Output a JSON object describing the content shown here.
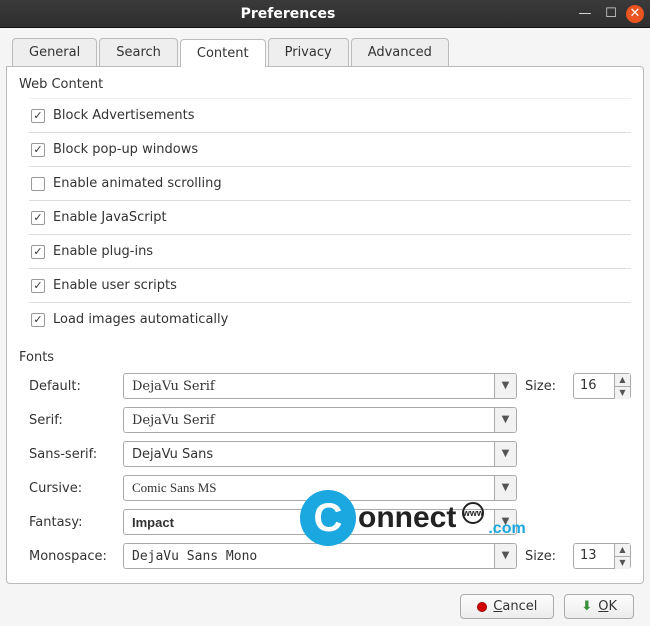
{
  "window": {
    "title": "Preferences"
  },
  "tabs": {
    "general": "General",
    "search": "Search",
    "content": "Content",
    "privacy": "Privacy",
    "advanced": "Advanced"
  },
  "sections": {
    "web_content": "Web Content",
    "fonts": "Fonts"
  },
  "checks": {
    "block_ads": {
      "label": "Block Advertisements",
      "checked": true
    },
    "block_popups": {
      "label": "Block pop-up windows",
      "checked": true
    },
    "animated_scroll": {
      "label": "Enable animated scrolling",
      "checked": false
    },
    "javascript": {
      "label": "Enable JavaScript",
      "checked": true
    },
    "plugins": {
      "label": "Enable plug-ins",
      "checked": true
    },
    "user_scripts": {
      "label": "Enable user scripts",
      "checked": true
    },
    "load_images": {
      "label": "Load images automatically",
      "checked": true
    }
  },
  "fonts": {
    "size_label": "Size:",
    "default": {
      "label": "Default:",
      "value": "DejaVu Serif",
      "size": "16"
    },
    "serif": {
      "label": "Serif:",
      "value": "DejaVu Serif"
    },
    "sans": {
      "label": "Sans-serif:",
      "value": "DejaVu Sans"
    },
    "cursive": {
      "label": "Cursive:",
      "value": "Comic Sans MS"
    },
    "fantasy": {
      "label": "Fantasy:",
      "value": "Impact"
    },
    "mono": {
      "label": "Monospace:",
      "value": "DejaVu Sans Mono",
      "size": "13"
    }
  },
  "buttons": {
    "cancel": "Cancel",
    "ok": "OK"
  },
  "watermark": {
    "c": "C",
    "text": "onnect",
    "globe": "www",
    "com": ".com"
  }
}
